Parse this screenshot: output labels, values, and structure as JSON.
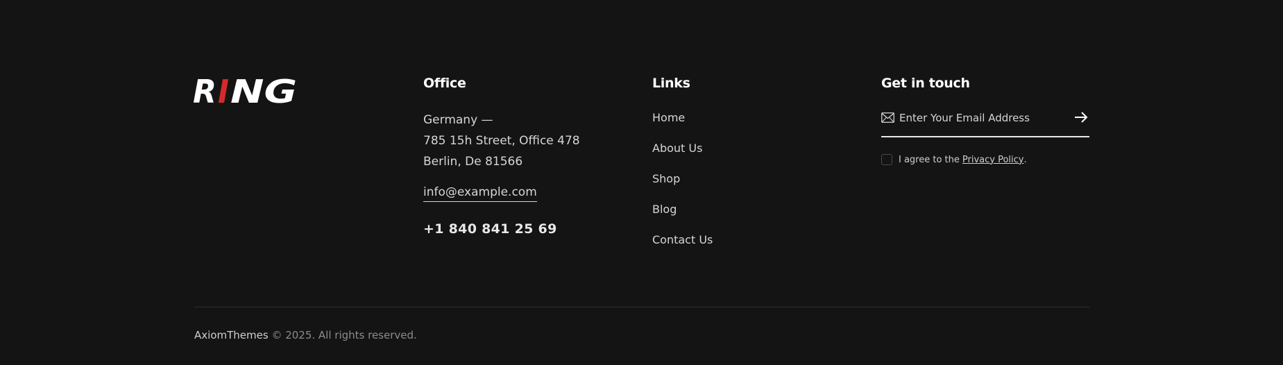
{
  "logo": {
    "text_left": "R",
    "text_red": "I",
    "text_right": "NG",
    "accent_color": "#d62a2a"
  },
  "office": {
    "heading": "Office",
    "address_lines": [
      "Germany —",
      "785 15h Street, Office 478",
      "Berlin, De 81566"
    ],
    "email": "info@example.com",
    "phone": "+1 840 841 25 69"
  },
  "links": {
    "heading": "Links",
    "items": [
      "Home",
      "About Us",
      "Shop",
      "Blog",
      "Contact Us"
    ]
  },
  "touch": {
    "heading": "Get in touch",
    "email_placeholder": "Enter Your Email Address",
    "mail_icon": "envelope-icon",
    "submit_icon": "arrow-right-icon",
    "agree_text": "I agree to the",
    "privacy_label": "Privacy Policy",
    "agree_suffix": "."
  },
  "bottom": {
    "brand": "AxiomThemes",
    "copyright": "© 2025. All rights reserved."
  },
  "colors": {
    "background": "#141414",
    "text": "#d6d6d6",
    "heading": "#ffffff",
    "accent": "#d62a2a"
  }
}
